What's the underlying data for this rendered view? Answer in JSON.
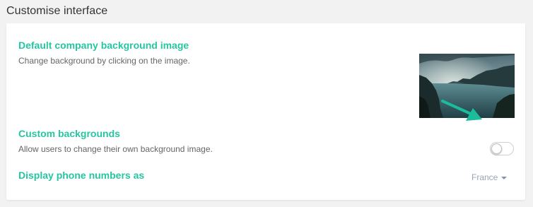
{
  "page": {
    "section_title": "Customise interface"
  },
  "settings": {
    "background_image": {
      "title": "Default company background image",
      "description": "Change background by clicking on the image."
    },
    "custom_backgrounds": {
      "title": "Custom backgrounds",
      "description": "Allow users to change their own background image.",
      "enabled": false
    },
    "phone_format": {
      "title": "Display phone numbers as",
      "selected": "France"
    }
  },
  "colors": {
    "accent": "#25c6a0",
    "arrow": "#1abc9c",
    "page_bg": "#f2f2f2",
    "card_bg": "#ffffff"
  },
  "icons": {
    "arrow": "arrow-pointing-to-toggle-icon",
    "dropdown": "caret-down-icon"
  }
}
